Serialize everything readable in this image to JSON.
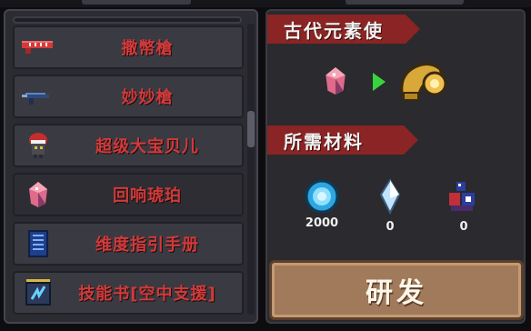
{
  "weapon_list": {
    "items": [
      {
        "label": "撒幣槍",
        "icon": "red-gun-icon"
      },
      {
        "label": "妙妙槍",
        "icon": "blue-gun-icon"
      },
      {
        "label": "超级大宝贝儿",
        "icon": "mask-creature-icon"
      },
      {
        "label": "回响琥珀",
        "icon": "amber-gem-icon"
      },
      {
        "label": "维度指引手册",
        "icon": "blue-book-icon"
      },
      {
        "label": "技能书[空中支援]",
        "icon": "skill-book-icon"
      }
    ]
  },
  "recipe": {
    "title": "古代元素使",
    "source_icon": "amber-gem-icon",
    "arrow_icon": "green-arrow-icon",
    "result_icon": "golden-horn-icon"
  },
  "materials": {
    "title": "所需材料",
    "items": [
      {
        "icon": "blue-gem-coin-icon",
        "count": "2000"
      },
      {
        "icon": "crystal-shard-icon",
        "count": "0"
      },
      {
        "icon": "blue-red-creature-icon",
        "count": "0"
      }
    ]
  },
  "craft_button": {
    "label": "研发"
  },
  "colors": {
    "list_text": "#d23a3a",
    "banner": "#8b2424",
    "button": "#a07a5a",
    "panel_bg": "#2a2a2f"
  }
}
